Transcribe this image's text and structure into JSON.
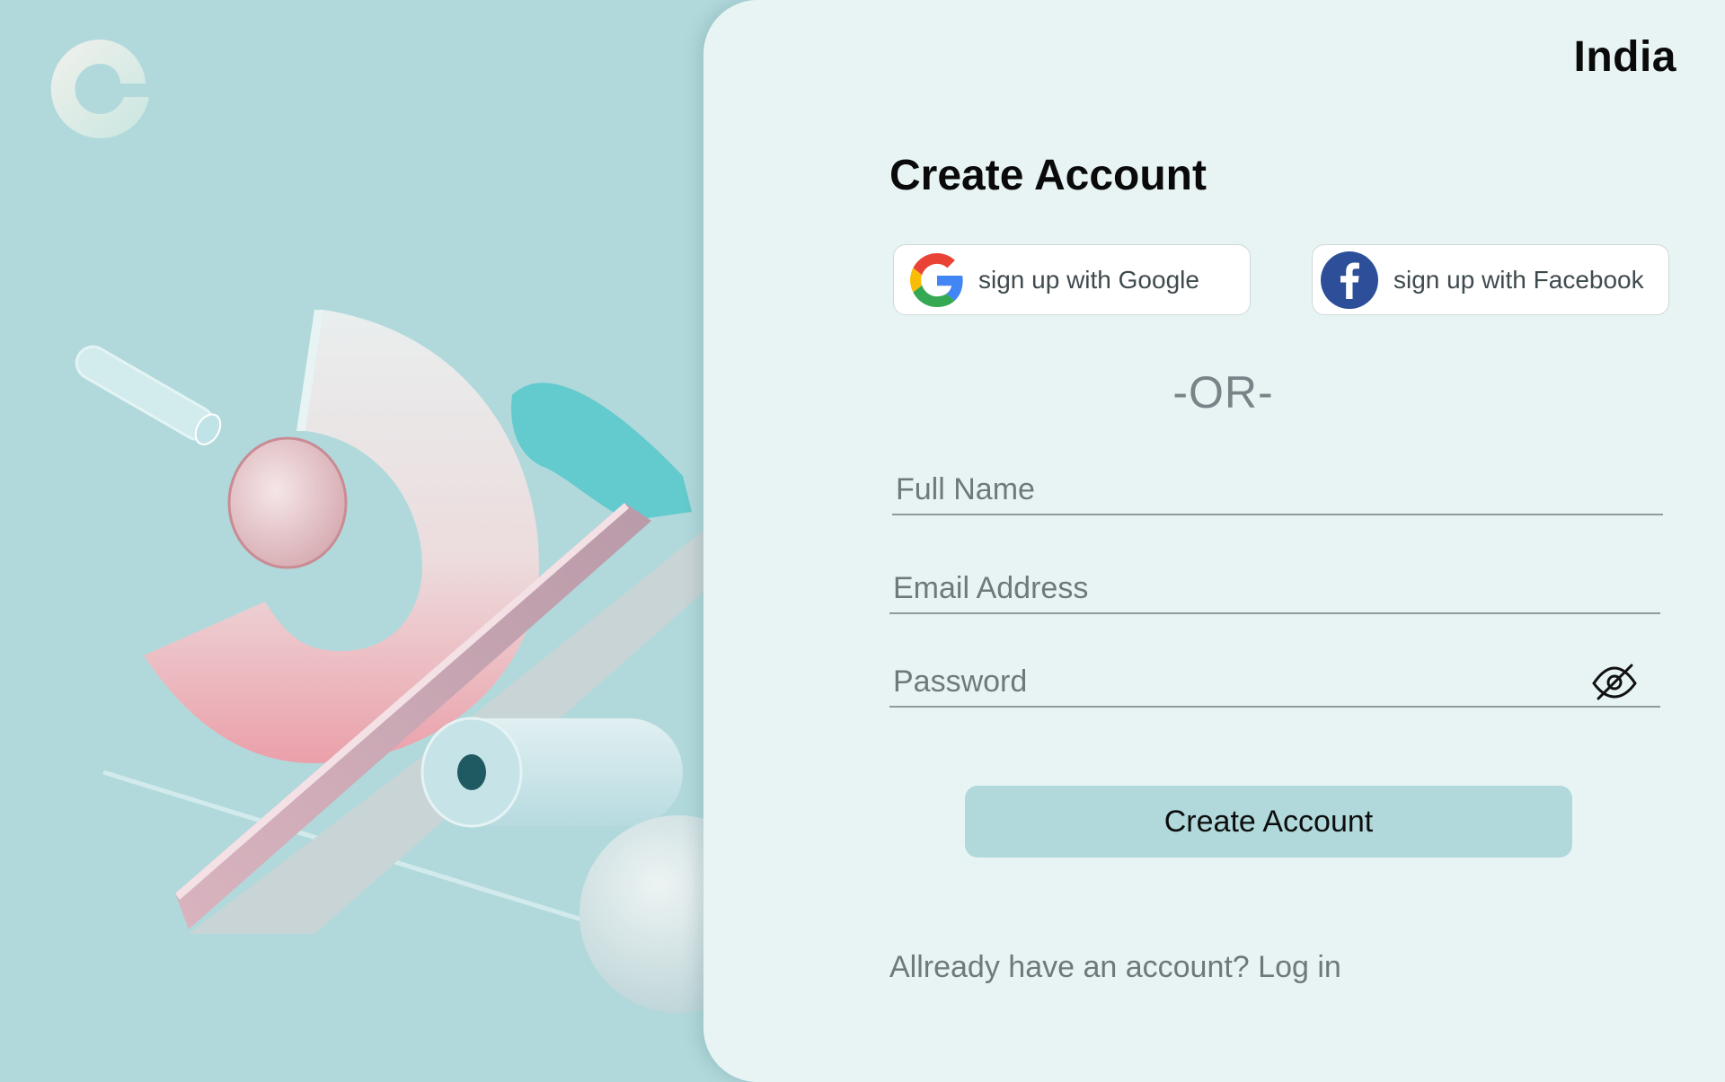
{
  "brand": {
    "logo": "c-logo-icon"
  },
  "header": {
    "region": "India"
  },
  "form": {
    "title": "Create Account",
    "social": {
      "google_label": "sign up with Google",
      "google_icon": "google-icon",
      "facebook_label": "sign up with Facebook",
      "facebook_icon": "facebook-icon"
    },
    "divider": "-OR-",
    "fields": {
      "full_name": {
        "placeholder": "Full Name",
        "value": ""
      },
      "email": {
        "placeholder": "Email Address",
        "value": ""
      },
      "password": {
        "placeholder": "Password",
        "value": "",
        "toggle_icon": "eye-off-icon"
      }
    },
    "submit_label": "Create Account",
    "footer": {
      "prompt": "Allready have an account?",
      "link": "Log in"
    }
  },
  "colors": {
    "page_bg": "#b1d9db",
    "card_bg": "#e8f4f4",
    "button_bg": "#b1d9db",
    "facebook_blue": "#2d4f99"
  }
}
